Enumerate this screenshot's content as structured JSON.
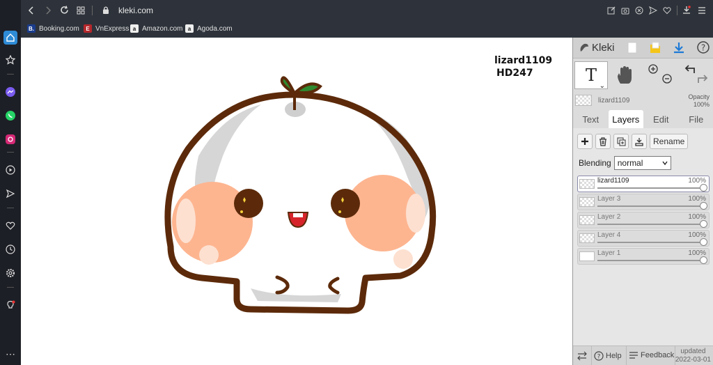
{
  "browser": {
    "url": "kleki.com",
    "bookmarks": [
      {
        "label": "Booking.com",
        "color": "#1a3c8c",
        "glyph": "B."
      },
      {
        "label": "VnExpress",
        "color": "#b4272b",
        "glyph": "E"
      },
      {
        "label": "Amazon.com",
        "color": "#eeeeee",
        "glyph": "a"
      },
      {
        "label": "Agoda.com",
        "color": "#eeeeee",
        "glyph": "a"
      }
    ]
  },
  "canvas": {
    "signature_line1": "lizard1109",
    "signature_line2": "HD247"
  },
  "kleki": {
    "app_name": "Kleki",
    "layer_name": "lizard1109",
    "opacity_label": "Opacity",
    "opacity_value": "100%",
    "tabs": [
      "Text",
      "Layers",
      "Edit",
      "File"
    ],
    "active_tab": "Layers",
    "rename_label": "Rename",
    "blending_label": "Blending",
    "blending_value": "normal",
    "layers": [
      {
        "name": "lizard1109",
        "opacity": "100%",
        "active": true
      },
      {
        "name": "Layer 3",
        "opacity": "100%",
        "active": false
      },
      {
        "name": "Layer 2",
        "opacity": "100%",
        "active": false
      },
      {
        "name": "Layer 4",
        "opacity": "100%",
        "active": false
      },
      {
        "name": "Layer 1",
        "opacity": "100%",
        "active": false
      }
    ],
    "footer": {
      "help": "Help",
      "feedback": "Feedback",
      "updated_label": "updated",
      "updated_date": "2022-03-01"
    }
  },
  "colors": {
    "outline": "#5c2a0a",
    "cheek": "#fdb590",
    "accent": "#1e7ad6"
  }
}
